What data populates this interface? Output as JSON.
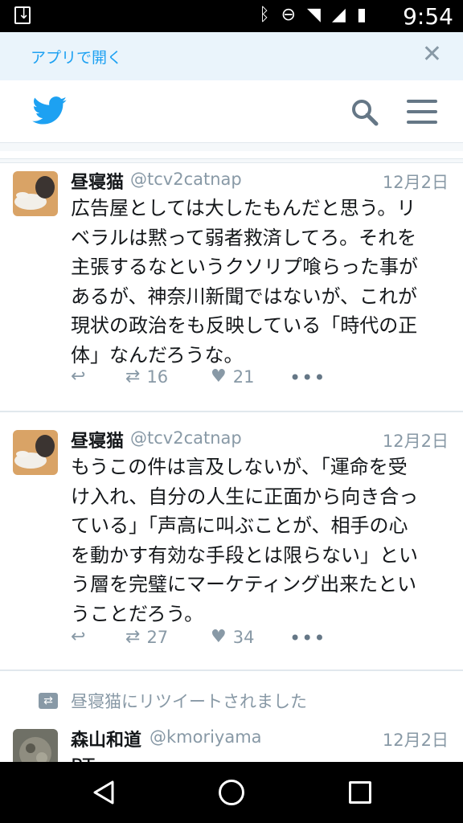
{
  "status_bar": {
    "time": "9:54"
  },
  "banner": {
    "open_in_app": "アプリで開く",
    "close_glyph": "✕"
  },
  "tweets": [
    {
      "name": "昼寝猫",
      "handle": "@tcv2catnap",
      "date": "12月2日",
      "lines": [
        "広告屋としては大したもんだと思う。リ",
        "ベラルは黙って弱者救済してろ。それを",
        "主張するなというクソリプ喰らった事が",
        "あるが、神奈川新聞ではないが、これが",
        "現状の政治をも反映している「時代の正",
        "体」なんだろうな。"
      ],
      "retweets": "16",
      "likes": "21"
    },
    {
      "name": "昼寝猫",
      "handle": "@tcv2catnap",
      "date": "12月2日",
      "lines": [
        "もうこの件は言及しないが、「運命を受",
        "け入れ、自分の人生に正面から向き合っ",
        "ている」「声高に叫ぶことが、相手の心",
        "を動かす有効な手段とは限らない」とい",
        "う層を完璧にマーケティング出来たとい",
        "うことだろう。"
      ],
      "retweets": "27",
      "likes": "34"
    },
    {
      "retweeted_by": "昼寝猫にリツイートされました",
      "name": "森山和道",
      "handle": "@kmoriyama",
      "date": "12月2日",
      "lines": [
        "RT"
      ]
    }
  ]
}
